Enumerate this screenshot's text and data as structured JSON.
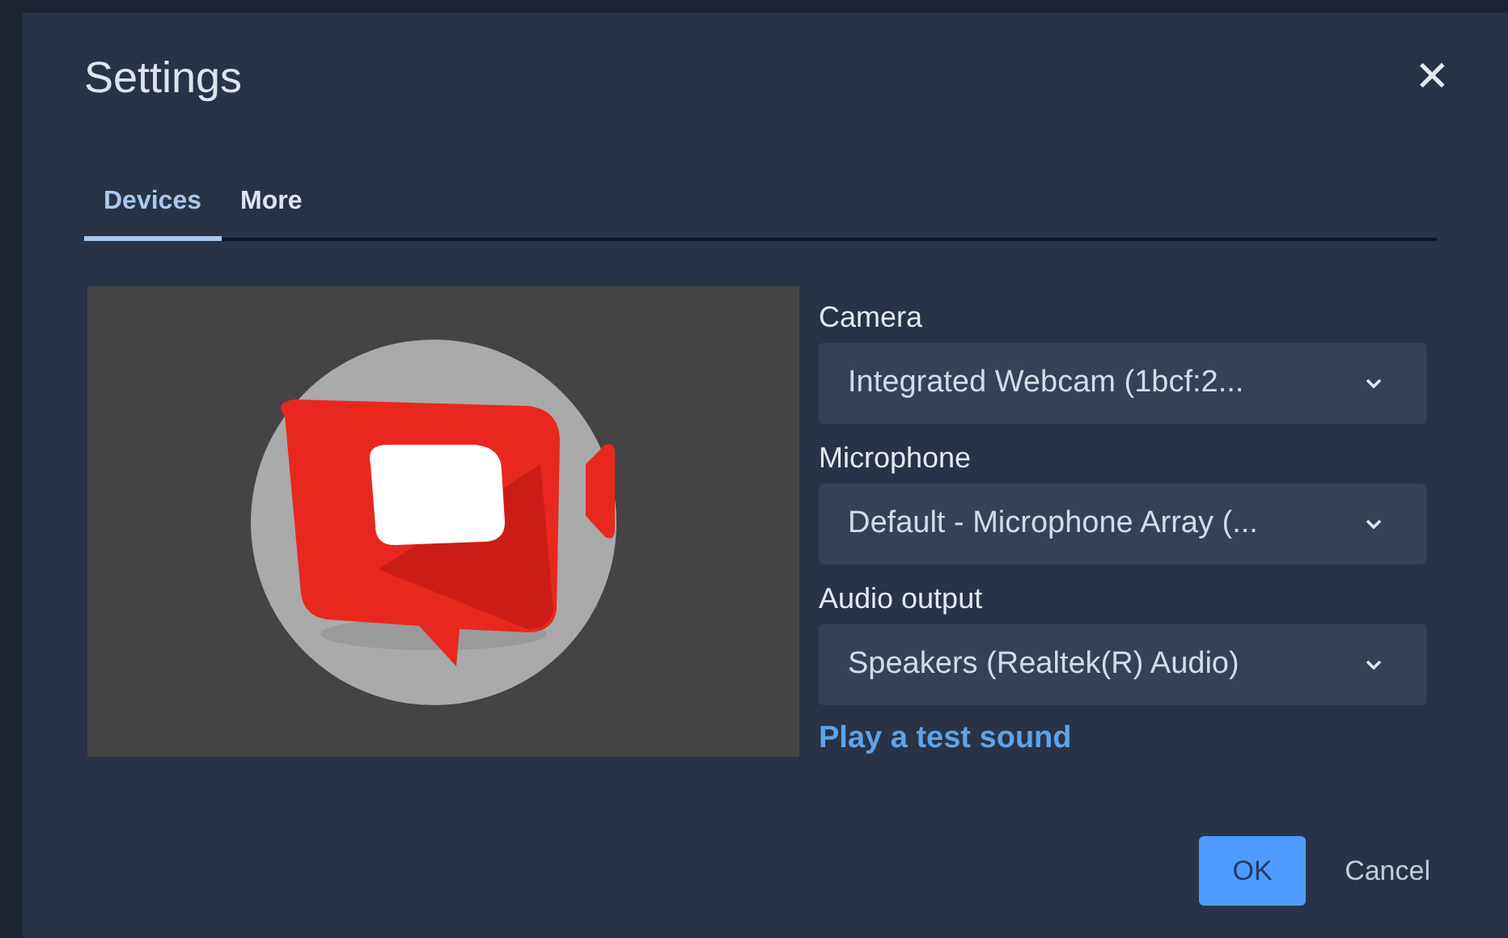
{
  "dialog": {
    "title": "Settings",
    "close": "✕"
  },
  "tabs": [
    {
      "label": "Devices",
      "selected": true
    },
    {
      "label": "More",
      "selected": false
    }
  ],
  "devices": [
    {
      "label": "Camera",
      "value": "Integrated Webcam (1bcf:2..."
    },
    {
      "label": "Microphone",
      "value": "Default - Microphone Array (..."
    },
    {
      "label": "Audio output",
      "value": "Speakers (Realtek(R) Audio)"
    }
  ],
  "test_sound_link": "Play a test sound",
  "buttons": [
    {
      "label": "OK",
      "kind": "primary"
    },
    {
      "label": "Cancel",
      "kind": "plain"
    }
  ]
}
